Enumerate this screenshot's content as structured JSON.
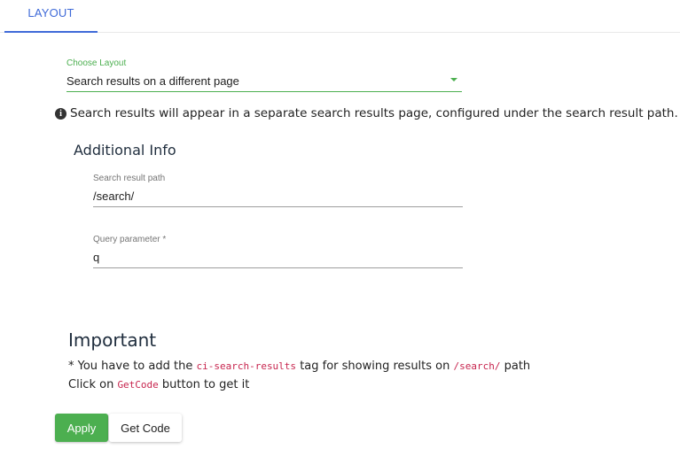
{
  "tabs": [
    {
      "label": "LAYOUT",
      "active": true
    }
  ],
  "choose_layout": {
    "label": "Choose Layout",
    "value": "Search results on a different page"
  },
  "info": {
    "icon": "info-circle-icon",
    "text": "Search results will appear in a separate search results page, configured under the search result path."
  },
  "additional_info": {
    "heading": "Additional Info",
    "search_result_path": {
      "label": "Search result path",
      "value": "/search/"
    },
    "query_parameter": {
      "label": "Query parameter *",
      "value": "q"
    }
  },
  "important": {
    "heading": "Important",
    "line1": {
      "prefix": "* You have to add the ",
      "code1": "ci-search-results",
      "middle": " tag for showing results on ",
      "code2": "/search/",
      "suffix": " path"
    },
    "line2": {
      "prefix": "Click on ",
      "code": "GetCode",
      "suffix": " button to get it"
    }
  },
  "buttons": {
    "apply": "Apply",
    "get_code": "Get Code"
  },
  "colors": {
    "accent_blue": "#3f6ad8",
    "green": "#4caf50",
    "code": "#c7254e"
  }
}
